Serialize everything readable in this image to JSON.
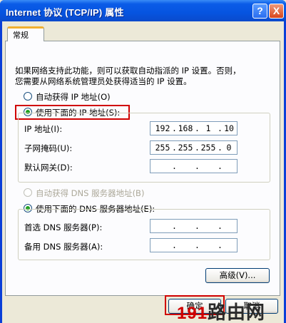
{
  "window": {
    "title": "Internet 协议 (TCP/IP) 属性",
    "help_label": "?",
    "close_label": "X"
  },
  "tab": {
    "label": "常规"
  },
  "description": {
    "line1": "如果网络支持此功能，则可以获取自动指派的 IP 设置。否则，",
    "line2": "您需要从网络系统管理员处获得适当的 IP 设置。"
  },
  "ip_section": {
    "auto_label": "自动获得 IP 地址(O)",
    "manual_label": "使用下面的 IP 地址(S):",
    "ip_label": "IP 地址(I):",
    "mask_label": "子网掩码(U):",
    "gateway_label": "默认网关(D):",
    "ip_value": [
      "192",
      "168",
      "1",
      "10"
    ],
    "mask_value": [
      "255",
      "255",
      "255",
      "0"
    ],
    "gateway_value": [
      "",
      "",
      "",
      ""
    ]
  },
  "dns_section": {
    "auto_label": "自动获得 DNS 服务器地址(B)",
    "manual_label": "使用下面的 DNS 服务器地址(E):",
    "preferred_label": "首选 DNS 服务器(P):",
    "alternate_label": "备用 DNS 服务器(A):",
    "preferred_value": [
      "",
      "",
      "",
      ""
    ],
    "alternate_value": [
      "",
      "",
      "",
      ""
    ]
  },
  "buttons": {
    "advanced": "高级(V)...",
    "ok": "确定",
    "cancel": "取消"
  },
  "watermark": {
    "num": "191",
    "text": "路由网"
  },
  "colors": {
    "highlight": "#d00000",
    "titlebar": "#0654e0",
    "radio_checked": "#21a121"
  }
}
